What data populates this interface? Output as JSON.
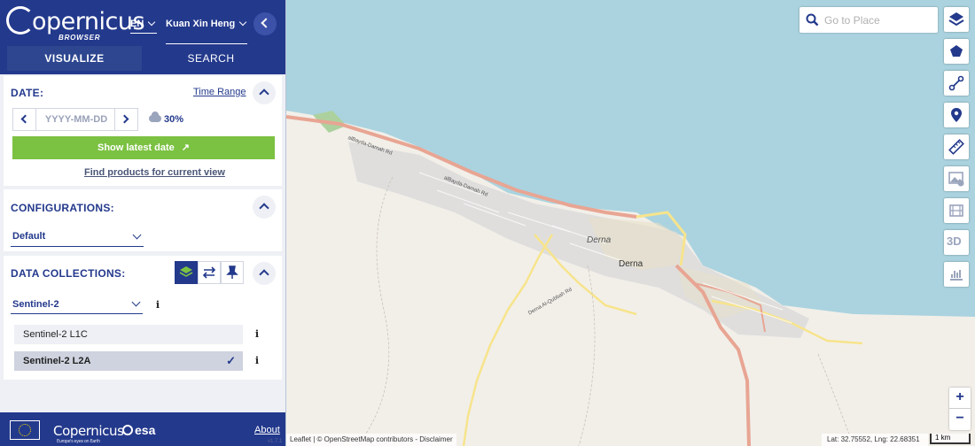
{
  "header": {
    "brand": "opernicus",
    "brand_sub": "BROWSER",
    "language": "EN",
    "user": "Kuan Xin Heng"
  },
  "tabs": {
    "visualize": "VISUALIZE",
    "search": "SEARCH"
  },
  "date_panel": {
    "title": "DATE:",
    "time_range": "Time Range",
    "date_placeholder": "YYYY-MM-DD",
    "cloud_coverage": "30%",
    "show_latest": "Show latest date",
    "find_products": "Find products for current view"
  },
  "config_panel": {
    "title": "CONFIGURATIONS:",
    "selected": "Default"
  },
  "data_panel": {
    "title": "DATA COLLECTIONS:",
    "dataset": "Sentinel-2",
    "collections": [
      {
        "label": "Sentinel-2 L1C",
        "selected": false
      },
      {
        "label": "Sentinel-2 L2A",
        "selected": true
      }
    ]
  },
  "footer": {
    "copernicus": "Copernicus",
    "copernicus_tagline": "Europe's eyes on Earth",
    "esa": "esa",
    "about": "About",
    "version": "v1.7.1"
  },
  "map": {
    "search_placeholder": "Go to Place",
    "labels": {
      "city_italic": "Derna",
      "city": "Derna",
      "road1": "alBayda-Darnah Rd",
      "road2": "alBayda-Darnah Rd",
      "road3": "Derna Al-Qubbah Rd"
    },
    "attribution": "Leaflet | © OpenStreetMap contributors - Disclaimer",
    "coords": "Lat: 32.75552, Lng: 22.68351",
    "scale": "1 km",
    "three_d": "3D"
  },
  "colors": {
    "brand_blue": "#23398c",
    "accent_green": "#7bc142",
    "sea": "#aad3df",
    "land": "#f2efe9"
  }
}
